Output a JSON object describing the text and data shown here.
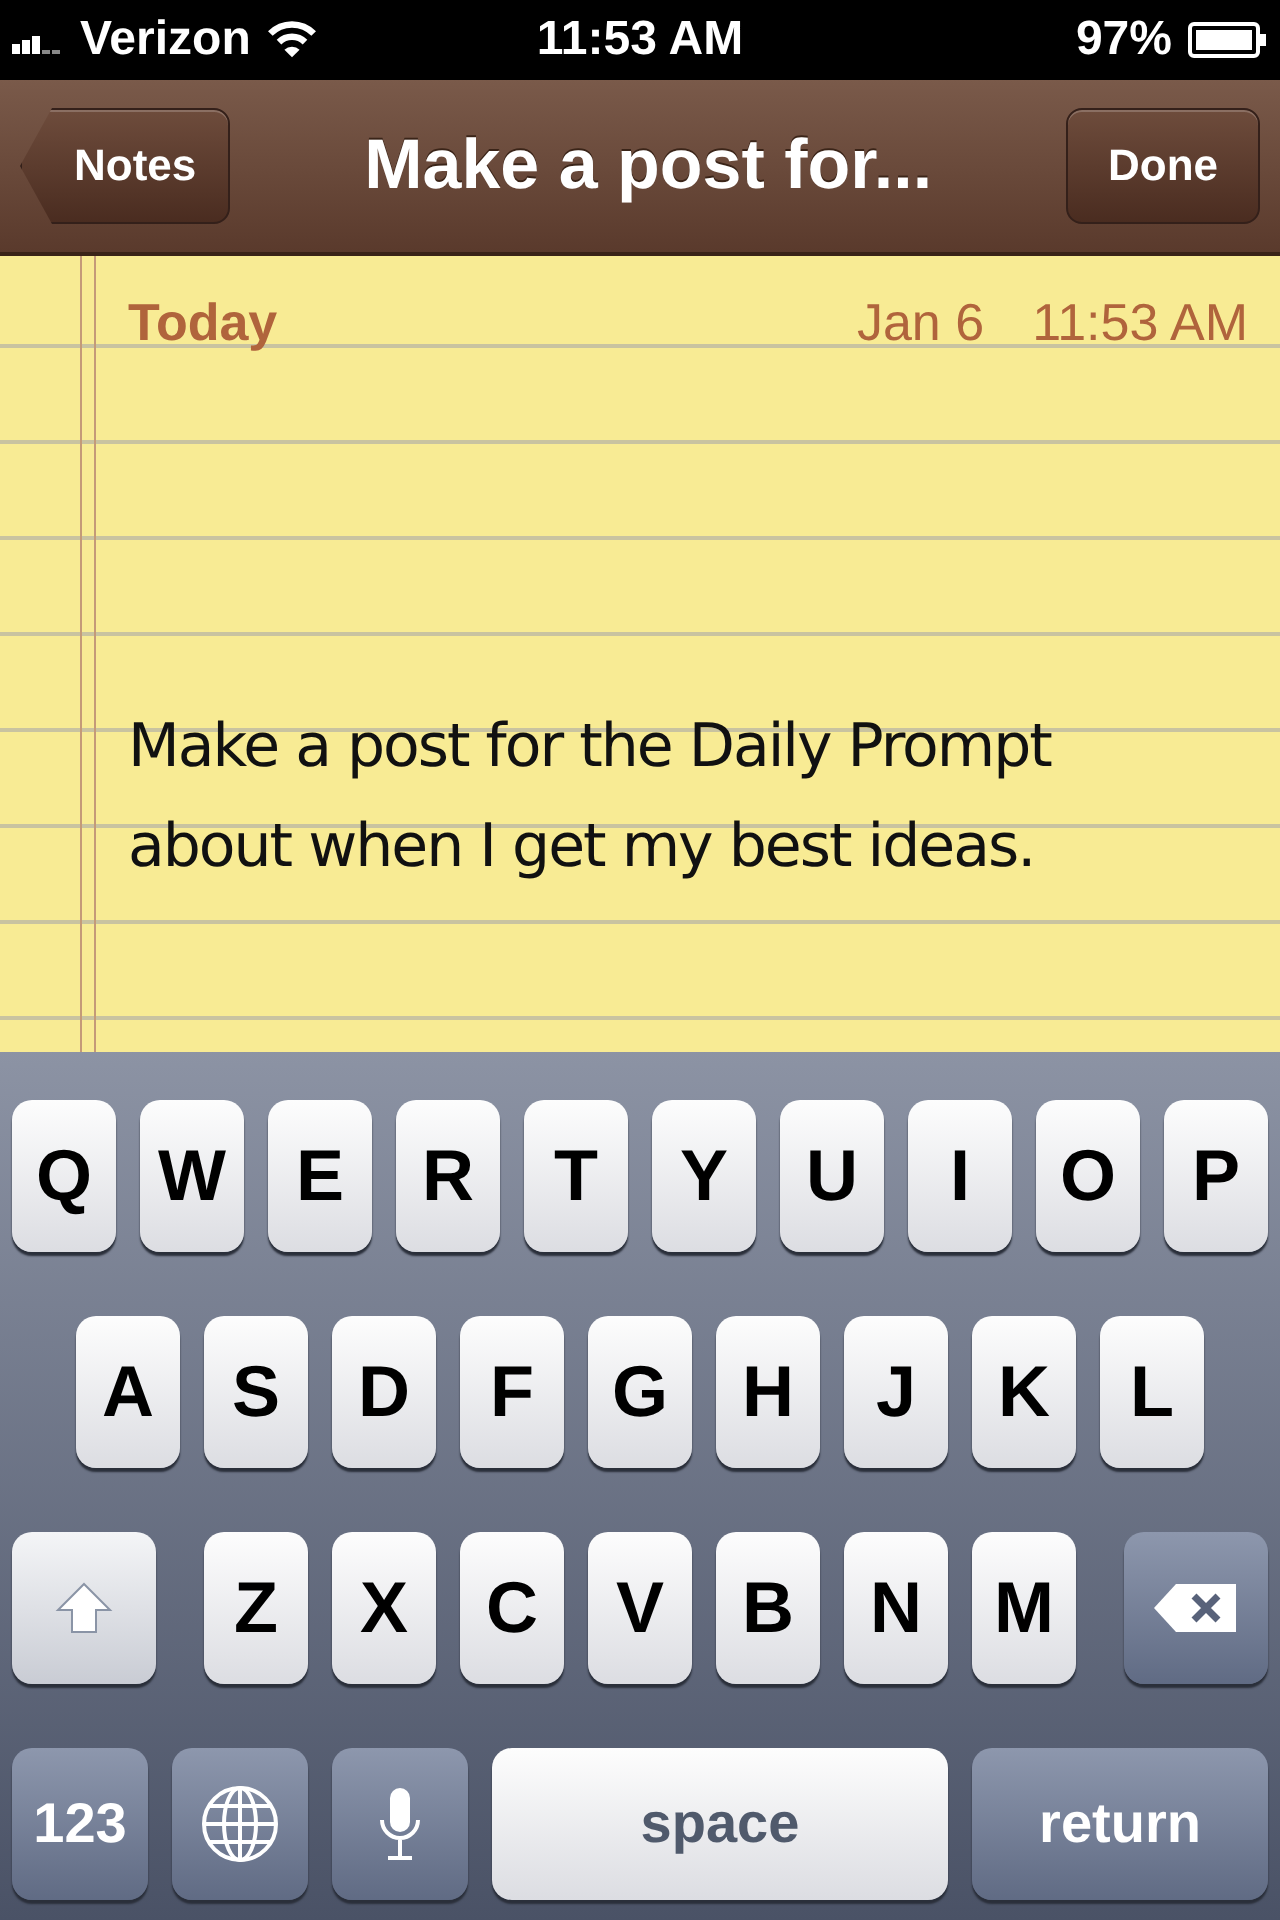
{
  "status_bar": {
    "carrier": "Verizon",
    "time": "11:53 AM",
    "battery": "97%"
  },
  "nav": {
    "back": "Notes",
    "title": "Make a post for...",
    "done": "Done"
  },
  "note": {
    "day": "Today",
    "date": "Jan 6",
    "time": "11:53 AM",
    "text": "Make a post for the Daily Prompt about when I get my best ideas."
  },
  "keyboard": {
    "top_row": [
      {
        "kind": "letter",
        "label": "Q"
      },
      {
        "kind": "letter",
        "label": "W"
      },
      {
        "kind": "letter",
        "label": "E"
      },
      {
        "kind": "letter",
        "label": "R"
      },
      {
        "kind": "letter",
        "label": "T"
      },
      {
        "kind": "letter",
        "label": "Y"
      },
      {
        "kind": "letter",
        "label": "U"
      },
      {
        "kind": "letter",
        "label": "I"
      },
      {
        "kind": "letter",
        "label": "O"
      },
      {
        "kind": "letter",
        "label": "P"
      }
    ],
    "home_row": [
      {
        "kind": "letter",
        "label": "A"
      },
      {
        "kind": "letter",
        "label": "S"
      },
      {
        "kind": "letter",
        "label": "D"
      },
      {
        "kind": "letter",
        "label": "F"
      },
      {
        "kind": "letter",
        "label": "G"
      },
      {
        "kind": "letter",
        "label": "H"
      },
      {
        "kind": "letter",
        "label": "J"
      },
      {
        "kind": "letter",
        "label": "K"
      },
      {
        "kind": "letter",
        "label": "L"
      }
    ],
    "lower_row": [
      {
        "kind": "shift",
        "on": true
      },
      {
        "kind": "letter",
        "label": "Z"
      },
      {
        "kind": "letter",
        "label": "X"
      },
      {
        "kind": "letter",
        "label": "C"
      },
      {
        "kind": "letter",
        "label": "V"
      },
      {
        "kind": "letter",
        "label": "B"
      },
      {
        "kind": "letter",
        "label": "N"
      },
      {
        "kind": "letter",
        "label": "M"
      },
      {
        "kind": "delete"
      }
    ],
    "function_row": [
      {
        "kind": "numbers",
        "label": "123"
      },
      {
        "kind": "globe"
      },
      {
        "kind": "mic"
      },
      {
        "kind": "space",
        "label": "space"
      },
      {
        "kind": "return",
        "label": "return"
      }
    ]
  }
}
